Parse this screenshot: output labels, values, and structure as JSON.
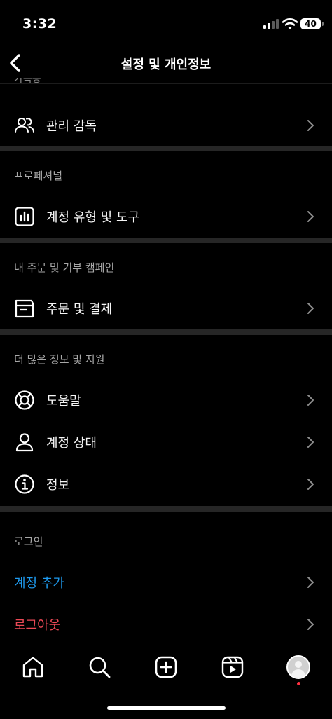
{
  "status_bar": {
    "time": "3:32",
    "battery": "40"
  },
  "header": {
    "title": "설정 및 개인정보"
  },
  "cutoff_section": {
    "label": "가족용"
  },
  "supervision": {
    "label": "관리 감독",
    "icon": "people-icon"
  },
  "professional": {
    "section_label": "프로페셔널",
    "items": [
      {
        "label": "계정 유형 및 도구",
        "icon": "bar-chart-icon"
      }
    ]
  },
  "orders": {
    "section_label": "내 주문 및 기부 캠페인",
    "items": [
      {
        "label": "주문 및 결제",
        "icon": "order-box-icon"
      }
    ]
  },
  "support": {
    "section_label": "더 많은 정보 및 지원",
    "items": [
      {
        "label": "도움말",
        "icon": "lifebuoy-icon"
      },
      {
        "label": "계정 상태",
        "icon": "person-icon"
      },
      {
        "label": "정보",
        "icon": "info-icon"
      }
    ]
  },
  "login": {
    "section_label": "로그인",
    "add_account": "계정 추가",
    "logout": "로그아웃"
  },
  "colors": {
    "link_blue": "#1e9bf0",
    "danger_red": "#ed4956",
    "divider": "#262626",
    "background": "#000000"
  },
  "tab_bar": {
    "icons": [
      "home-icon",
      "search-icon",
      "create-icon",
      "reels-icon",
      "profile-avatar"
    ]
  }
}
